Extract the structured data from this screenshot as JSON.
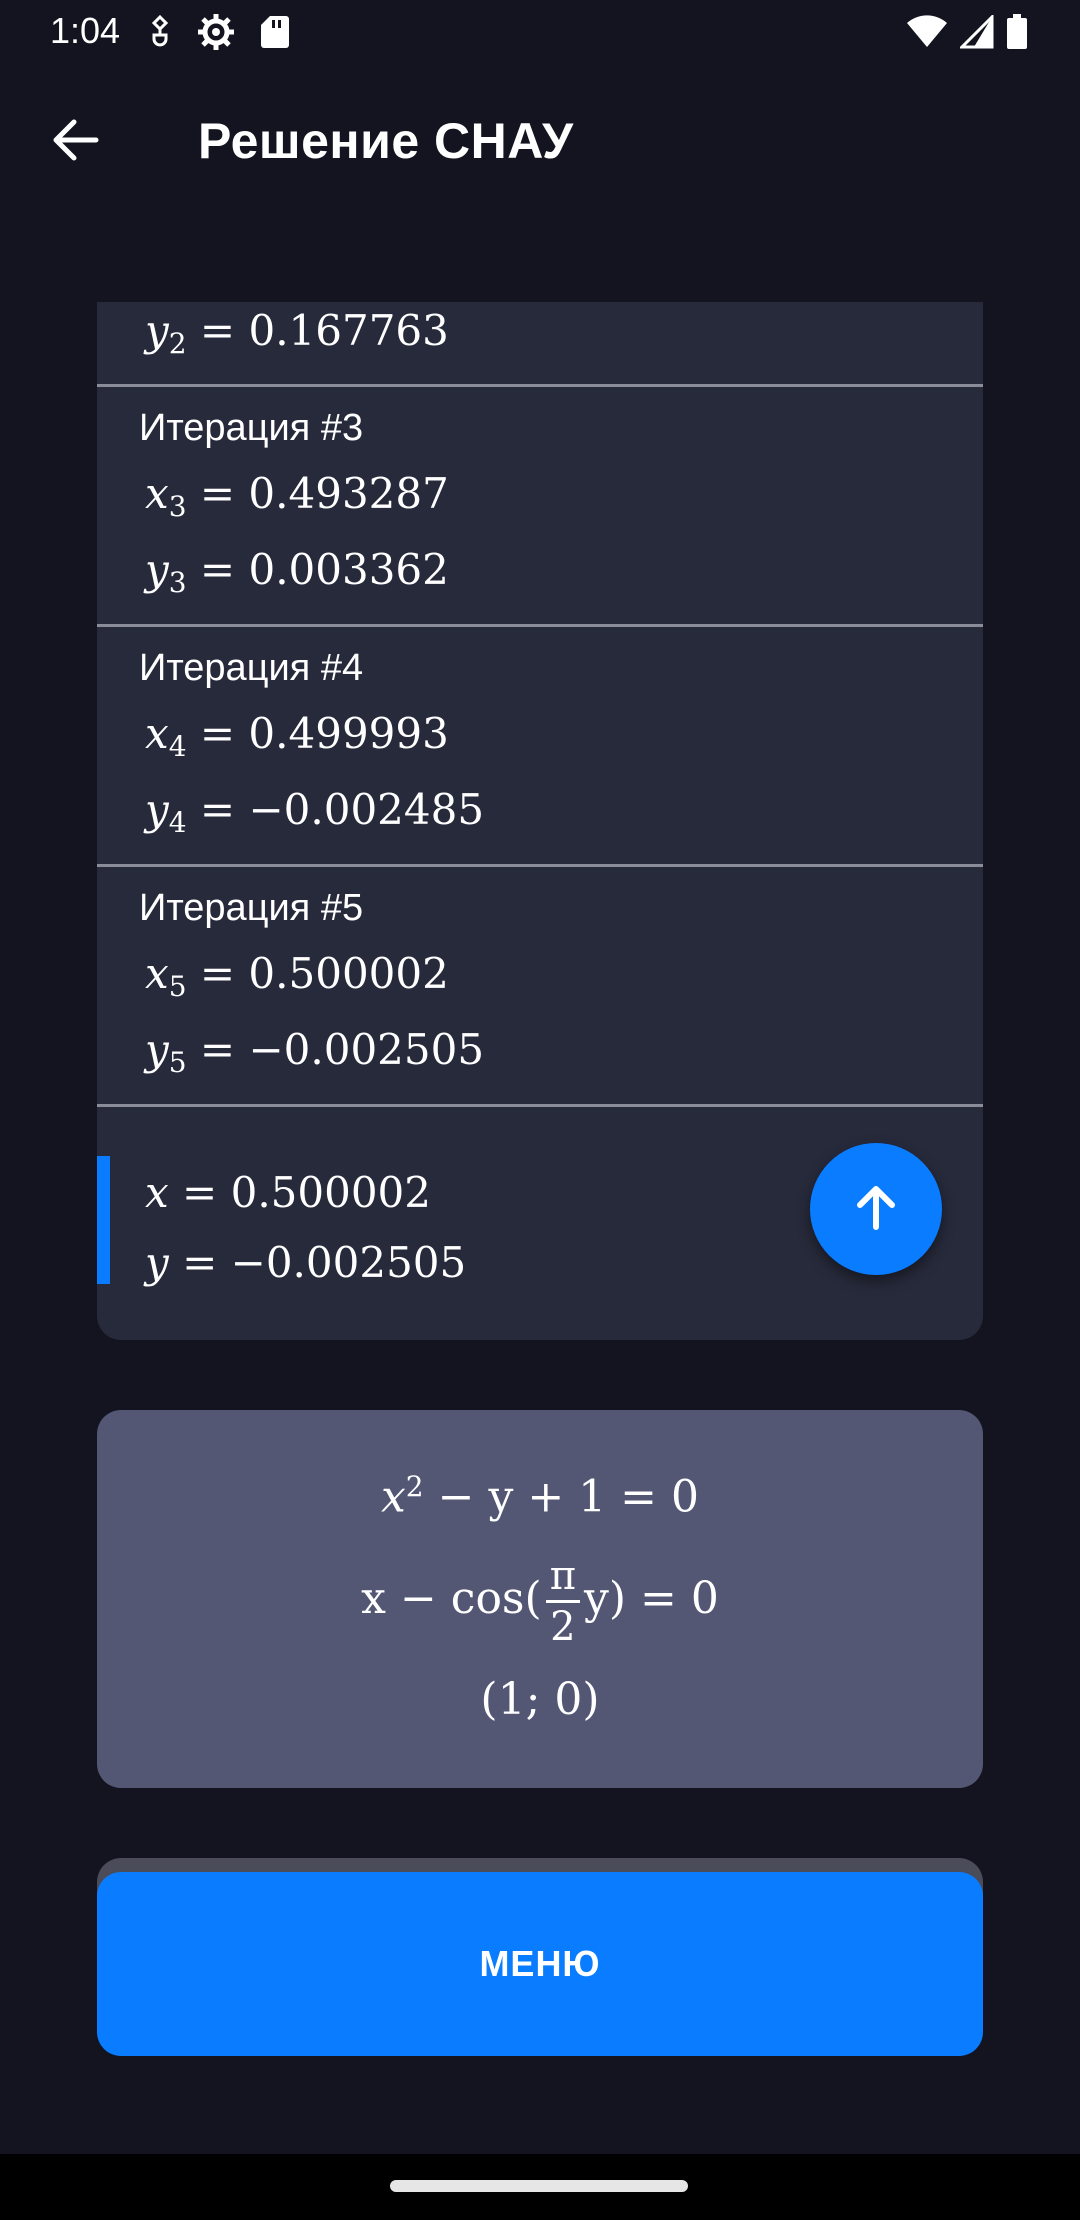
{
  "status_bar": {
    "time": "1:04",
    "left_icons": [
      "vpn-key-icon",
      "settings-gear-icon",
      "sd-card-icon"
    ],
    "right_icons": [
      "wifi-icon",
      "cellular-signal-icon",
      "battery-icon"
    ]
  },
  "app_bar": {
    "title": "Решение СНАУ",
    "back_icon": "arrow-left-icon"
  },
  "iterations": {
    "partial_row": {
      "var": "y",
      "index": "2",
      "value": "0.167763"
    },
    "items": [
      {
        "label": "Итерация #3",
        "x_index": "3",
        "x_value": "0.493287",
        "y_index": "3",
        "y_value": "0.003362"
      },
      {
        "label": "Итерация #4",
        "x_index": "4",
        "x_value": "0.499993",
        "y_index": "4",
        "y_value": "−0.002485"
      },
      {
        "label": "Итерация #5",
        "x_index": "5",
        "x_value": "0.500002",
        "y_index": "5",
        "y_value": "−0.002505"
      }
    ],
    "result": {
      "x_value": "0.500002",
      "y_value": "−0.002505"
    }
  },
  "fab": {
    "icon": "arrow-up-icon",
    "color": "#0a7cff"
  },
  "system": {
    "eq1_tail": "− y + 1 = 0",
    "eq2_lead": "x − cos(",
    "eq2_num": "π",
    "eq2_den": "2",
    "eq2_tail": "y) = 0",
    "initial": "(1; 0)"
  },
  "menu_button": {
    "label": "МЕНЮ",
    "color": "#0a7cff"
  }
}
